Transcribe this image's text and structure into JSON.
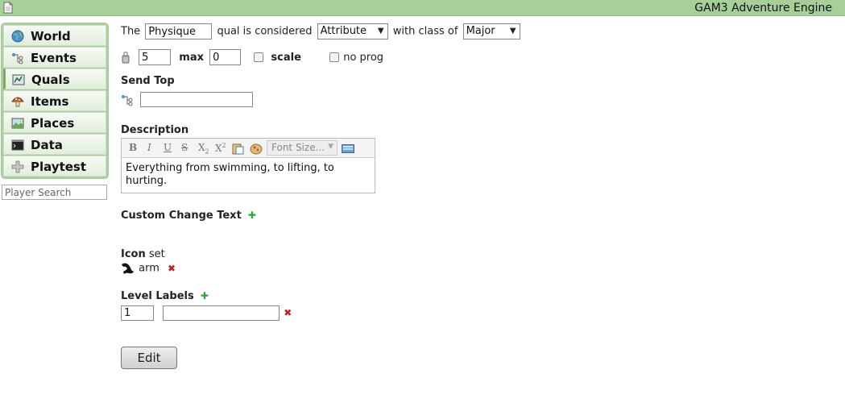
{
  "app": {
    "title": "GAM3 Adventure Engine"
  },
  "sidebar": {
    "items": [
      {
        "label": "World",
        "icon": "globe-icon"
      },
      {
        "label": "Events",
        "icon": "events-icon"
      },
      {
        "label": "Quals",
        "icon": "quals-icon"
      },
      {
        "label": "Items",
        "icon": "mushroom-icon"
      },
      {
        "label": "Places",
        "icon": "picture-icon"
      },
      {
        "label": "Data",
        "icon": "terminal-icon"
      },
      {
        "label": "Playtest",
        "icon": "puzzle-icon"
      }
    ],
    "search_placeholder": "Player Search"
  },
  "qual": {
    "prefix": "The",
    "name": "Physique",
    "mid": "qual is considered",
    "category": "Attribute",
    "class_label": "with class of",
    "class_value": "Major",
    "value": "5",
    "max_label": "max",
    "max_value": "0",
    "scale_label": "scale",
    "noprog_label": "no prog"
  },
  "send_top": {
    "label": "Send Top",
    "value": ""
  },
  "description": {
    "label": "Description",
    "font_size_placeholder": "Font Size...",
    "text": "Everything from swimming, to lifting, to hurting."
  },
  "custom_change": {
    "label": "Custom Change Text"
  },
  "icon_section": {
    "label": "Icon",
    "set_link": "set",
    "icon_name": "arm"
  },
  "level_labels": {
    "label": "Level Labels",
    "level": "1",
    "text": ""
  },
  "edit_button": "Edit"
}
